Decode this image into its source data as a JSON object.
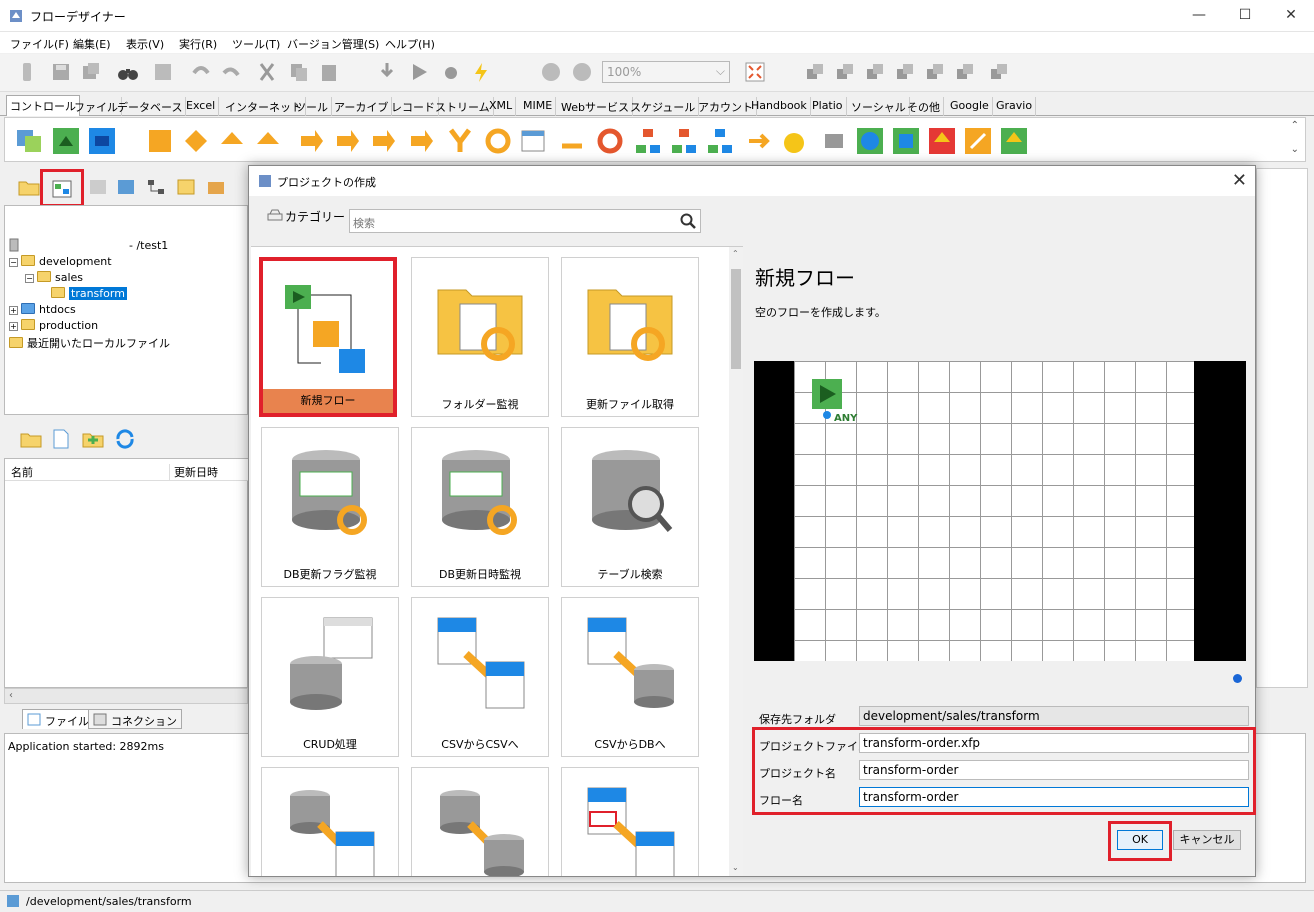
{
  "window": {
    "title": "フローデザイナー",
    "min": "—",
    "max": "☐",
    "close": "✕"
  },
  "menu": [
    "ファイル(F)",
    "編集(E)",
    "表示(V)",
    "実行(R)",
    "ツール(T)",
    "バージョン管理(S)",
    "ヘルプ(H)"
  ],
  "toolbar": {
    "zoom": "100%"
  },
  "palette_tabs": [
    "コントロール",
    "ファイル",
    "データベース",
    "Excel",
    "インターネット",
    "ツール",
    "アーカイブ",
    "レコード",
    "ストリーム",
    "XML",
    "MIME",
    "Webサービス",
    "スケジュール",
    "アカウント",
    "Handbook",
    "Platio",
    "ソーシャル",
    "その他",
    "Google",
    "Gravio"
  ],
  "tree": {
    "root": "- /test1",
    "items": [
      "development",
      "sales",
      "transform",
      "htdocs",
      "production",
      "最近開いたローカルファイル"
    ]
  },
  "file_list": {
    "col_name": "名前",
    "col_updated": "更新日時"
  },
  "bottom_tabs": [
    "ファイル",
    "コネクション"
  ],
  "log": "Application started: 2892ms",
  "status_path": "/development/sales/transform",
  "dialog": {
    "title": "プロジェクトの作成",
    "category_label": "カテゴリー",
    "search_placeholder": "検索",
    "templates": [
      "新規フロー",
      "フォルダー監視",
      "更新ファイル取得",
      "DB更新フラグ監視",
      "DB更新日時監視",
      "テーブル検索",
      "CRUD処理",
      "CSVからCSVへ",
      "CSVからDBへ",
      "",
      "",
      ""
    ],
    "selected_template": "新規フロー",
    "detail_title": "新規フロー",
    "detail_desc": "空のフローを作成します。",
    "preview_any": "ANY",
    "form": {
      "folder_label": "保存先フォルダ",
      "folder_value": "development/sales/transform",
      "file_label": "プロジェクトファイル名",
      "file_value": "transform-order.xfp",
      "project_label": "プロジェクト名",
      "project_value": "transform-order",
      "flow_label": "フロー名",
      "flow_value": "transform-order"
    },
    "ok": "OK",
    "cancel": "キャンセル"
  },
  "colors": {
    "accent_red": "#e0202b",
    "selected_tile": "#e8834e",
    "tree_selection": "#0078d7"
  }
}
